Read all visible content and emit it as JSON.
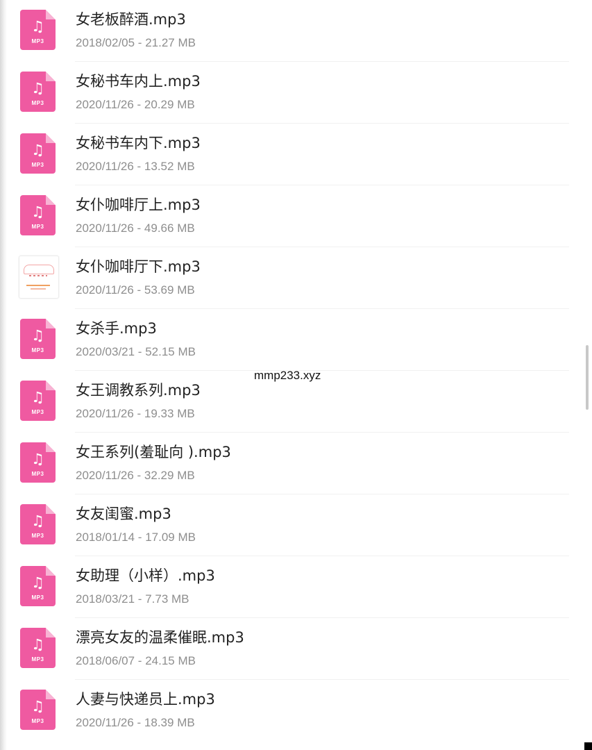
{
  "files": [
    {
      "name": "女老板醉酒.mp3",
      "date": "2018/02/05",
      "size": "21.27 MB",
      "meta": "2018/02/05 - 21.27 MB",
      "icon": "mp3-icon"
    },
    {
      "name": "女秘书车内上.mp3",
      "date": "2020/11/26",
      "size": "20.29 MB",
      "meta": "2020/11/26 - 20.29 MB",
      "icon": "mp3-icon"
    },
    {
      "name": "女秘书车内下.mp3",
      "date": "2020/11/26",
      "size": "13.52 MB",
      "meta": "2020/11/26 - 13.52 MB",
      "icon": "mp3-icon"
    },
    {
      "name": "女仆咖啡厅上.mp3",
      "date": "2020/11/26",
      "size": "49.66 MB",
      "meta": "2020/11/26 - 49.66 MB",
      "icon": "mp3-icon"
    },
    {
      "name": "女仆咖啡厅下.mp3",
      "date": "2020/11/26",
      "size": "53.69 MB",
      "meta": "2020/11/26 - 53.69 MB",
      "icon": "album-thumbnail-icon"
    },
    {
      "name": "女杀手.mp3",
      "date": "2020/03/21",
      "size": "52.15 MB",
      "meta": "2020/03/21 - 52.15 MB",
      "icon": "mp3-icon"
    },
    {
      "name": "女王调教系列.mp3",
      "date": "2020/11/26",
      "size": "19.33 MB",
      "meta": "2020/11/26 - 19.33 MB",
      "icon": "mp3-icon"
    },
    {
      "name": "女王系列(羞耻向 ).mp3",
      "date": "2020/11/26",
      "size": "32.29 MB",
      "meta": "2020/11/26 - 32.29 MB",
      "icon": "mp3-icon"
    },
    {
      "name": "女友闺蜜.mp3",
      "date": "2018/01/14",
      "size": "17.09 MB",
      "meta": "2018/01/14 - 17.09 MB",
      "icon": "mp3-icon"
    },
    {
      "name": "女助理（小样）.mp3",
      "date": "2018/03/21",
      "size": "7.73 MB",
      "meta": "2018/03/21 - 7.73 MB",
      "icon": "mp3-icon"
    },
    {
      "name": "漂亮女友的温柔催眠.mp3",
      "date": "2018/06/07",
      "size": "24.15 MB",
      "meta": "2018/06/07 - 24.15 MB",
      "icon": "mp3-icon"
    },
    {
      "name": "人妻与快递员上.mp3",
      "date": "2020/11/26",
      "size": "18.39 MB",
      "meta": "2020/11/26 - 18.39 MB",
      "icon": "mp3-icon"
    }
  ],
  "icon_text": {
    "mp3_tag": "MP3",
    "note_glyph": "♫"
  },
  "watermark": "mmp233.xyz",
  "colors": {
    "mp3_icon": "#ef5aa1",
    "file_name": "#222222",
    "file_meta": "#8e8e8e"
  }
}
